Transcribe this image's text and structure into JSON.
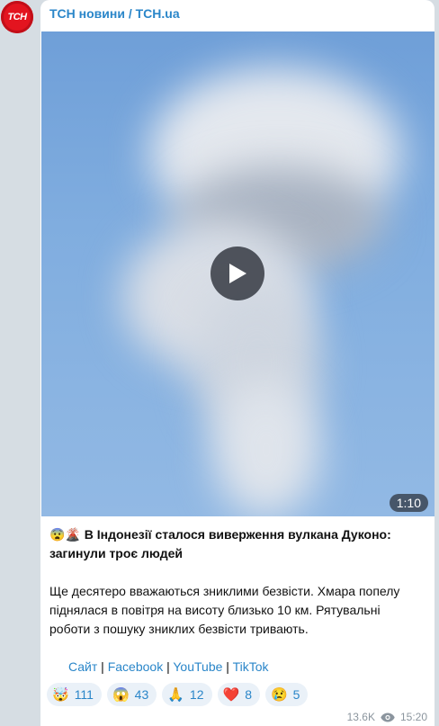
{
  "channel": {
    "avatar_text": "ТСН",
    "name": "ТСН новини / ТСН.ua"
  },
  "video": {
    "duration": "1:10"
  },
  "post": {
    "headline_emoji": "😨🌋",
    "headline": "В Індонезії сталося виверження вулкана Дуконо: загинули троє людей",
    "body": "Ще десятеро вважаються зниклими безвісти. Хмара попелу піднялася в повітря на висоту близько 10 км. Рятувальні роботи з пошуку зниклих безвісти тривають.",
    "links": {
      "site": "Сайт",
      "sep1": " | ",
      "facebook": "Facebook",
      "sep2": " | ",
      "youtube": "YouTube",
      "sep3": " | ",
      "tiktok": "TikTok"
    }
  },
  "reactions": [
    {
      "emoji": "🤯",
      "count": "111"
    },
    {
      "emoji": "😱",
      "count": "43"
    },
    {
      "emoji": "🙏",
      "count": "12"
    },
    {
      "emoji": "❤️",
      "count": "8"
    },
    {
      "emoji": "😢",
      "count": "5"
    }
  ],
  "meta": {
    "views": "13.6K",
    "time": "15:20"
  }
}
